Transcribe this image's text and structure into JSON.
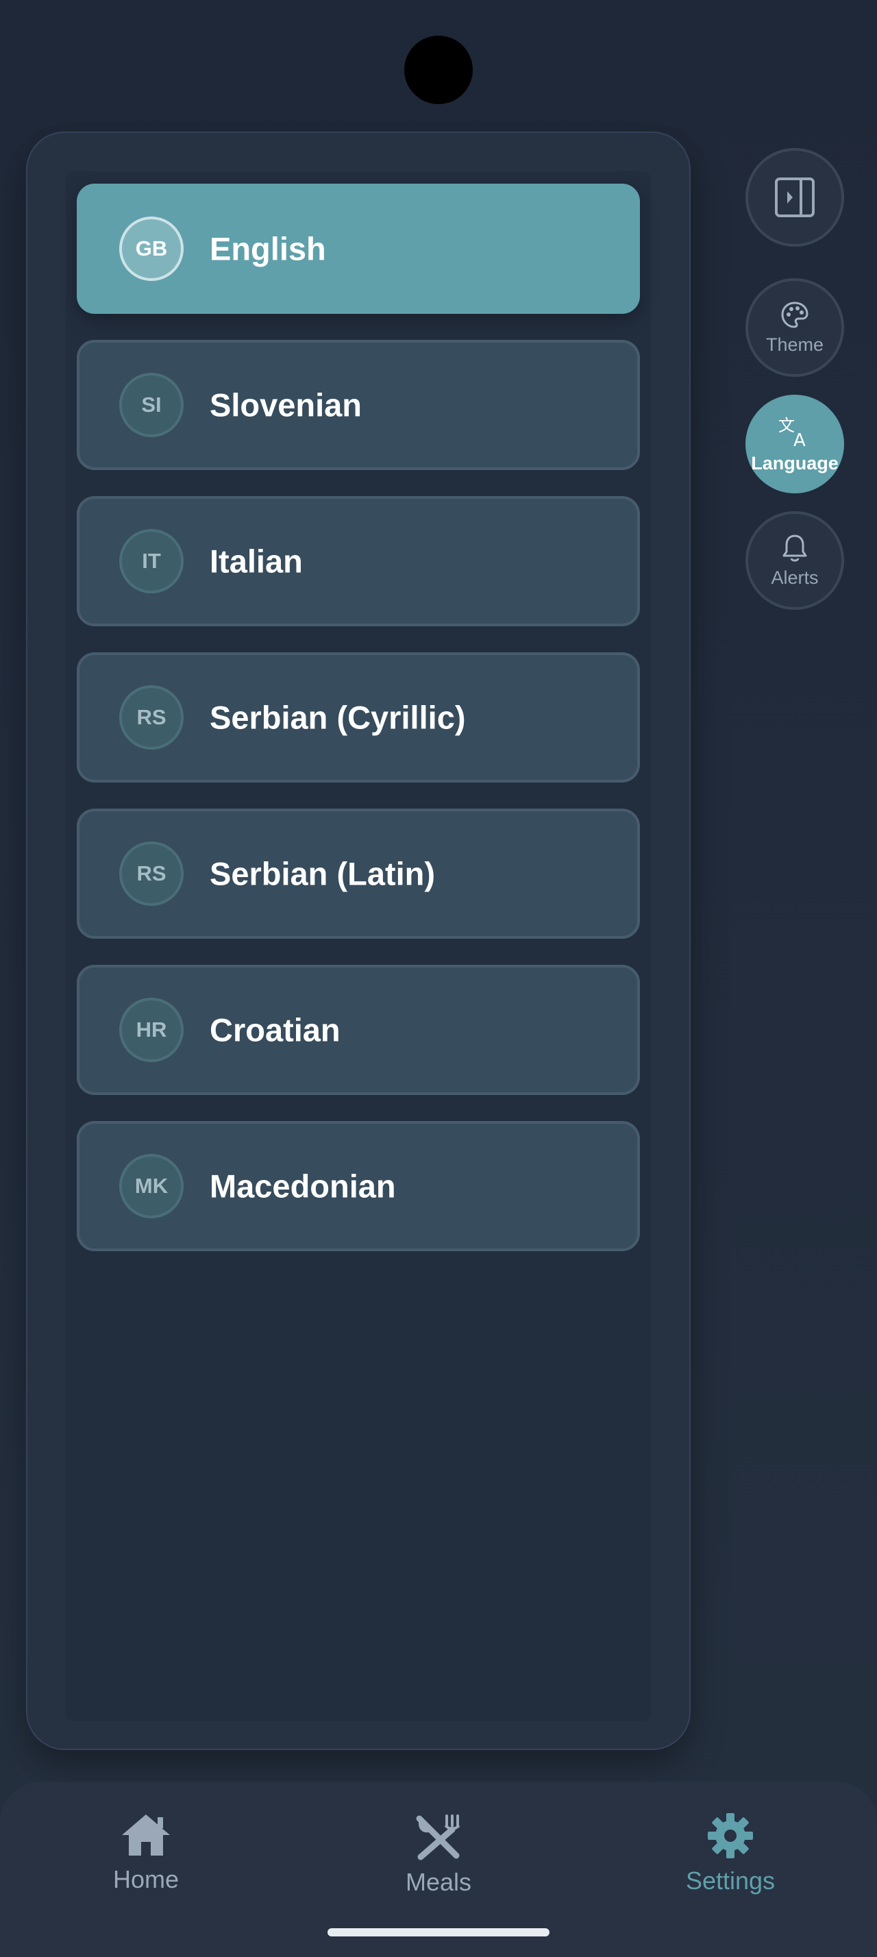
{
  "languages": [
    {
      "code": "GB",
      "name": "English",
      "selected": true
    },
    {
      "code": "SI",
      "name": "Slovenian",
      "selected": false
    },
    {
      "code": "IT",
      "name": "Italian",
      "selected": false
    },
    {
      "code": "RS",
      "name": "Serbian (Cyrillic)",
      "selected": false
    },
    {
      "code": "RS",
      "name": "Serbian (Latin)",
      "selected": false
    },
    {
      "code": "HR",
      "name": "Croatian",
      "selected": false
    },
    {
      "code": "MK",
      "name": "Macedonian",
      "selected": false
    }
  ],
  "rail": {
    "toggle_icon": "sidebar-toggle-icon",
    "theme_label": "Theme",
    "language_label": "Language",
    "alerts_label": "Alerts",
    "active": "Language"
  },
  "bottom_nav": {
    "items": [
      {
        "label": "Home",
        "icon": "home-icon"
      },
      {
        "label": "Meals",
        "icon": "fork-knife-icon"
      },
      {
        "label": "Settings",
        "icon": "gear-icon"
      }
    ],
    "active": "Settings"
  },
  "colors": {
    "accent": "#5fa0ab",
    "background": "#1f2838",
    "card": "#374c5c"
  }
}
